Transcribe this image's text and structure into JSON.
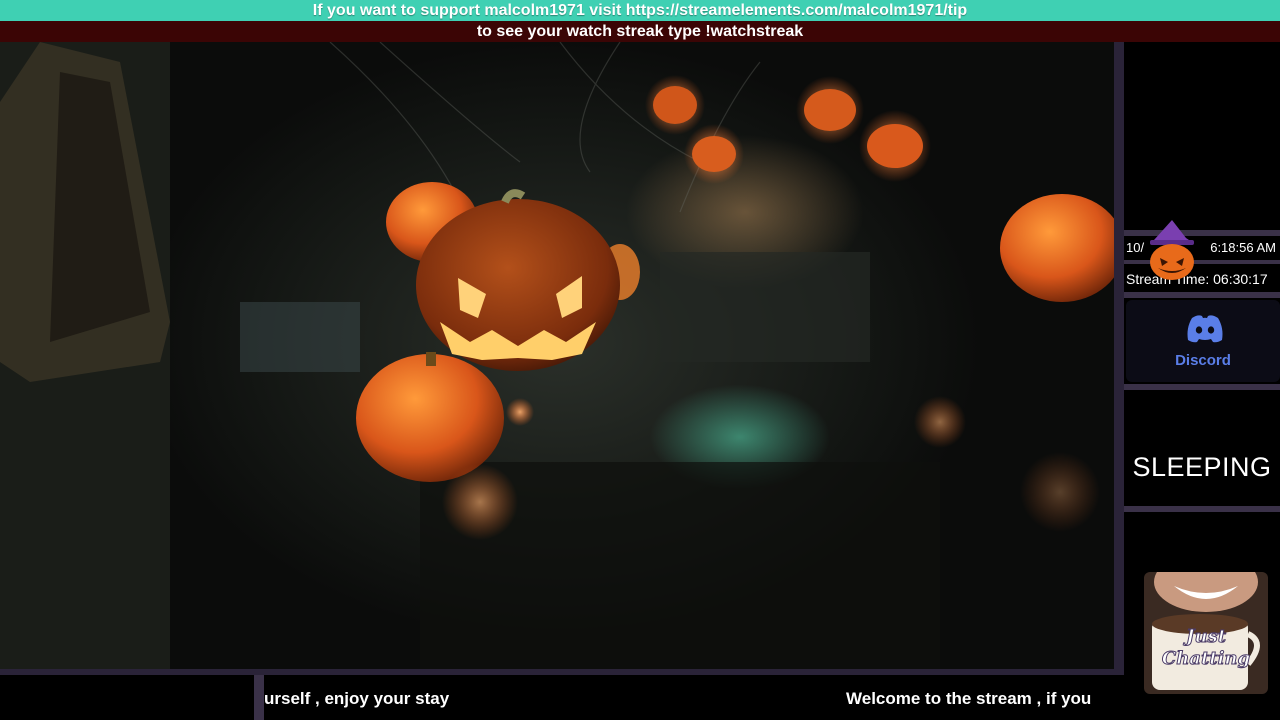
{
  "banner": {
    "support_text": "If you want to support malcolm1971 visit https://streamelements.com/malcolm1971/tip",
    "watchstreak_text": "to see your watch streak type !watchstreak"
  },
  "sidebar": {
    "date": "10/",
    "time": "6:18:56 AM",
    "stream_time": "Stream Time: 06:30:17",
    "discord_label": "Discord",
    "status": "SLEEPING",
    "category_badge_text": "Just Chatting"
  },
  "ticker": {
    "segment_1": "urself ,  enjoy your stay",
    "segment_2": "Welcome to the stream ,  if you"
  },
  "colors": {
    "banner_bg": "#3fd0b3",
    "sub_banner_bg": "#3b0505",
    "frame_border": "#2a2338",
    "discord_accent": "#5a7ee8",
    "pumpkin_orange": "#e86a1a"
  },
  "icons": [
    "pumpkin-hat-icon",
    "discord-icon"
  ]
}
